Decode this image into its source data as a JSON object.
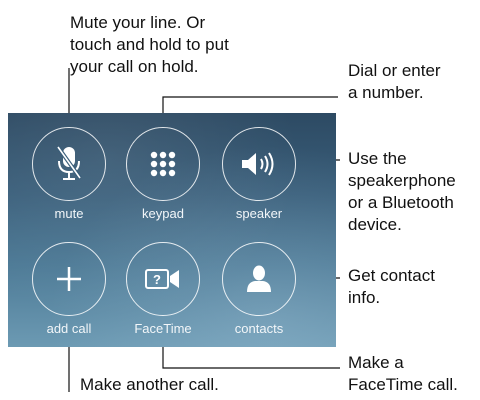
{
  "callouts": {
    "mute": "Mute your line. Or\ntouch and hold to put\nyour call on hold.",
    "keypad": "Dial or enter\na number.",
    "speaker": "Use the\nspeakerphone\nor a Bluetooth\ndevice.",
    "contacts": "Get contact\ninfo.",
    "facetime": "Make a\nFaceTime call.",
    "add_call": "Make another call."
  },
  "buttons": [
    {
      "label": "mute",
      "icon": "microphone-slash-icon"
    },
    {
      "label": "keypad",
      "icon": "keypad-grid-icon"
    },
    {
      "label": "speaker",
      "icon": "speaker-icon"
    },
    {
      "label": "add call",
      "icon": "plus-icon"
    },
    {
      "label": "FaceTime",
      "icon": "facetime-camera-icon"
    },
    {
      "label": "contacts",
      "icon": "contact-person-icon"
    }
  ],
  "facetime_icon_glyph": "?",
  "colors": {
    "panel_top": "#2d4a63",
    "panel_bottom": "#6c9ab3",
    "leader_line": "#111111",
    "button_ring": "#ffffff"
  }
}
